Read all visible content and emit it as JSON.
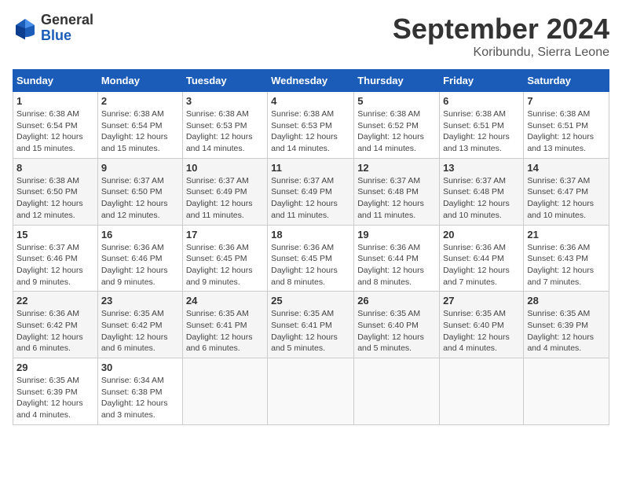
{
  "header": {
    "logo_general": "General",
    "logo_blue": "Blue",
    "month_title": "September 2024",
    "location": "Koribundu, Sierra Leone"
  },
  "days_of_week": [
    "Sunday",
    "Monday",
    "Tuesday",
    "Wednesday",
    "Thursday",
    "Friday",
    "Saturday"
  ],
  "weeks": [
    [
      {
        "day": "1",
        "sunrise": "6:38 AM",
        "sunset": "6:54 PM",
        "daylight": "12 hours and 15 minutes."
      },
      {
        "day": "2",
        "sunrise": "6:38 AM",
        "sunset": "6:54 PM",
        "daylight": "12 hours and 15 minutes."
      },
      {
        "day": "3",
        "sunrise": "6:38 AM",
        "sunset": "6:53 PM",
        "daylight": "12 hours and 14 minutes."
      },
      {
        "day": "4",
        "sunrise": "6:38 AM",
        "sunset": "6:53 PM",
        "daylight": "12 hours and 14 minutes."
      },
      {
        "day": "5",
        "sunrise": "6:38 AM",
        "sunset": "6:52 PM",
        "daylight": "12 hours and 14 minutes."
      },
      {
        "day": "6",
        "sunrise": "6:38 AM",
        "sunset": "6:51 PM",
        "daylight": "12 hours and 13 minutes."
      },
      {
        "day": "7",
        "sunrise": "6:38 AM",
        "sunset": "6:51 PM",
        "daylight": "12 hours and 13 minutes."
      }
    ],
    [
      {
        "day": "8",
        "sunrise": "6:38 AM",
        "sunset": "6:50 PM",
        "daylight": "12 hours and 12 minutes."
      },
      {
        "day": "9",
        "sunrise": "6:37 AM",
        "sunset": "6:50 PM",
        "daylight": "12 hours and 12 minutes."
      },
      {
        "day": "10",
        "sunrise": "6:37 AM",
        "sunset": "6:49 PM",
        "daylight": "12 hours and 11 minutes."
      },
      {
        "day": "11",
        "sunrise": "6:37 AM",
        "sunset": "6:49 PM",
        "daylight": "12 hours and 11 minutes."
      },
      {
        "day": "12",
        "sunrise": "6:37 AM",
        "sunset": "6:48 PM",
        "daylight": "12 hours and 11 minutes."
      },
      {
        "day": "13",
        "sunrise": "6:37 AM",
        "sunset": "6:48 PM",
        "daylight": "12 hours and 10 minutes."
      },
      {
        "day": "14",
        "sunrise": "6:37 AM",
        "sunset": "6:47 PM",
        "daylight": "12 hours and 10 minutes."
      }
    ],
    [
      {
        "day": "15",
        "sunrise": "6:37 AM",
        "sunset": "6:46 PM",
        "daylight": "12 hours and 9 minutes."
      },
      {
        "day": "16",
        "sunrise": "6:36 AM",
        "sunset": "6:46 PM",
        "daylight": "12 hours and 9 minutes."
      },
      {
        "day": "17",
        "sunrise": "6:36 AM",
        "sunset": "6:45 PM",
        "daylight": "12 hours and 9 minutes."
      },
      {
        "day": "18",
        "sunrise": "6:36 AM",
        "sunset": "6:45 PM",
        "daylight": "12 hours and 8 minutes."
      },
      {
        "day": "19",
        "sunrise": "6:36 AM",
        "sunset": "6:44 PM",
        "daylight": "12 hours and 8 minutes."
      },
      {
        "day": "20",
        "sunrise": "6:36 AM",
        "sunset": "6:44 PM",
        "daylight": "12 hours and 7 minutes."
      },
      {
        "day": "21",
        "sunrise": "6:36 AM",
        "sunset": "6:43 PM",
        "daylight": "12 hours and 7 minutes."
      }
    ],
    [
      {
        "day": "22",
        "sunrise": "6:36 AM",
        "sunset": "6:42 PM",
        "daylight": "12 hours and 6 minutes."
      },
      {
        "day": "23",
        "sunrise": "6:35 AM",
        "sunset": "6:42 PM",
        "daylight": "12 hours and 6 minutes."
      },
      {
        "day": "24",
        "sunrise": "6:35 AM",
        "sunset": "6:41 PM",
        "daylight": "12 hours and 6 minutes."
      },
      {
        "day": "25",
        "sunrise": "6:35 AM",
        "sunset": "6:41 PM",
        "daylight": "12 hours and 5 minutes."
      },
      {
        "day": "26",
        "sunrise": "6:35 AM",
        "sunset": "6:40 PM",
        "daylight": "12 hours and 5 minutes."
      },
      {
        "day": "27",
        "sunrise": "6:35 AM",
        "sunset": "6:40 PM",
        "daylight": "12 hours and 4 minutes."
      },
      {
        "day": "28",
        "sunrise": "6:35 AM",
        "sunset": "6:39 PM",
        "daylight": "12 hours and 4 minutes."
      }
    ],
    [
      {
        "day": "29",
        "sunrise": "6:35 AM",
        "sunset": "6:39 PM",
        "daylight": "12 hours and 4 minutes."
      },
      {
        "day": "30",
        "sunrise": "6:34 AM",
        "sunset": "6:38 PM",
        "daylight": "12 hours and 3 minutes."
      },
      null,
      null,
      null,
      null,
      null
    ]
  ]
}
